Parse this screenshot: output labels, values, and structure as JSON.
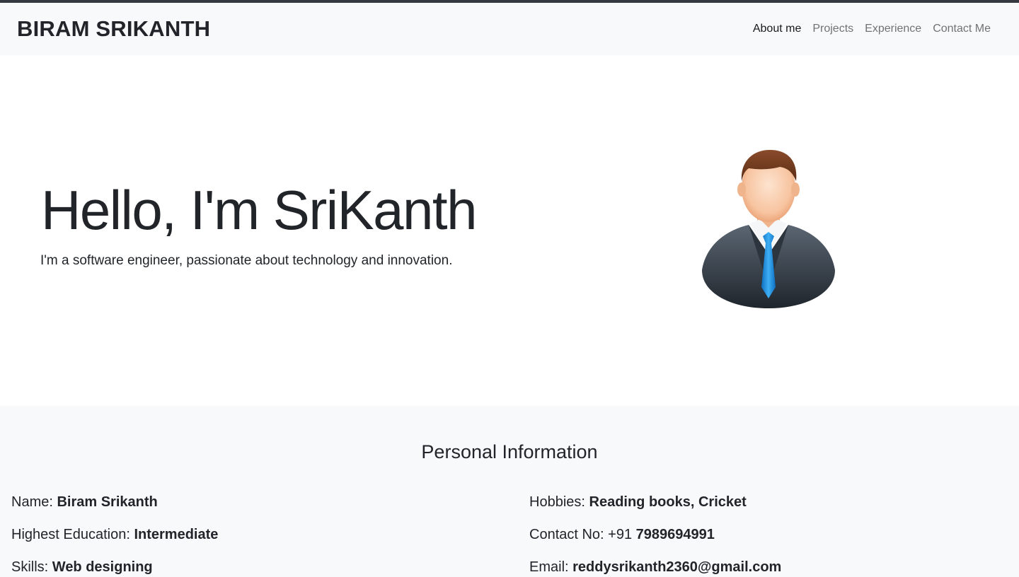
{
  "navbar": {
    "brand": "BIRAM SRIKANTH",
    "links": [
      {
        "label": "About me",
        "active": true
      },
      {
        "label": "Projects",
        "active": false
      },
      {
        "label": "Experience",
        "active": false
      },
      {
        "label": "Contact Me",
        "active": false
      }
    ]
  },
  "hero": {
    "title": "Hello, I'm SriKanth",
    "subtitle": "I'm a software engineer, passionate about technology and innovation.",
    "avatar_icon": "businessman-avatar-icon"
  },
  "personal_info": {
    "title": "Personal Information",
    "left": [
      {
        "label": "Name:",
        "value": "Biram Srikanth"
      },
      {
        "label": "Highest Education:",
        "value": "Intermediate"
      },
      {
        "label": "Skills:",
        "value": "Web designing"
      }
    ],
    "right": [
      {
        "label": "Hobbies:",
        "value": "Reading books, Cricket"
      },
      {
        "label": "Contact No: +91",
        "value": "7989694991"
      },
      {
        "label": "Email:",
        "value": "reddysrikanth2360@gmail.com"
      }
    ]
  },
  "colors": {
    "navbar_bg": "#f8f9fa",
    "top_border": "#343a40",
    "text": "#212529",
    "tie": "#1e88e5",
    "suit": "#3a4450"
  }
}
